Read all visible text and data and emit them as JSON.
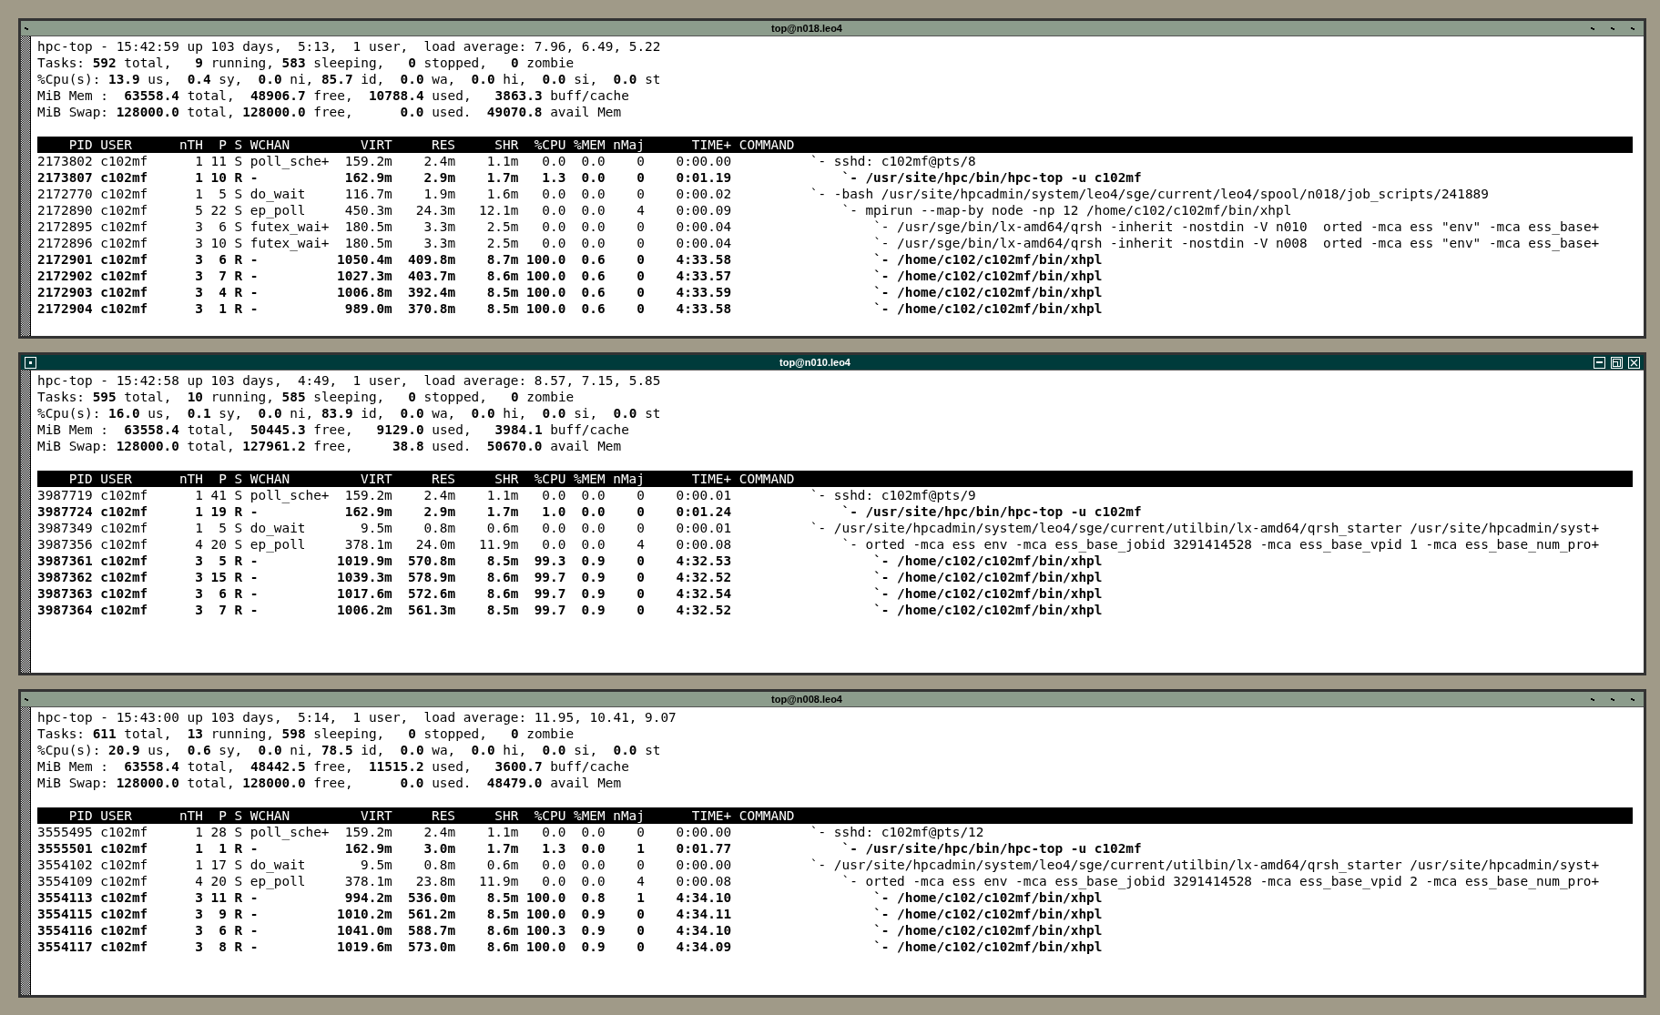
{
  "windows": [
    {
      "title": "top@n018.leo4",
      "active": false,
      "summary": [
        "hpc-top - 15:42:59 up 103 days,  5:13,  1 user,  load average: 7.96, 6.49, 5.22",
        "Tasks: **592** total,   **9** running, **583** sleeping,   **0** stopped,   **0** zombie",
        "%Cpu(s): **13.9** us,  **0.4** sy,  **0.0** ni, **85.7** id,  **0.0** wa,  **0.0** hi,  **0.0** si,  **0.0** st",
        "MiB Mem :  **63558.4** total,  **48906.7** free,  **10788.4** used,   **3863.3** buff/cache",
        "MiB Swap: **128000.0** total, **128000.0** free,      **0.0** used.  **49070.8** avail Mem"
      ],
      "columns": [
        "PID",
        "USER",
        "nTH",
        "P",
        "S",
        "WCHAN",
        "VIRT",
        "RES",
        "SHR",
        "%CPU",
        "%MEM",
        "nMaj",
        "TIME+",
        "COMMAND"
      ],
      "processes": [
        {
          "cells": [
            "2173802",
            "c102mf",
            "1",
            "11",
            "S",
            "poll_sche+",
            "159.2m",
            "2.4m",
            "1.1m",
            "0.0",
            "0.0",
            "0",
            "0:00.00"
          ],
          "command": "`- sshd: c102mf@pts/8",
          "highlighted": false,
          "children": [
            {
              "cells": [
                "2173807",
                "c102mf",
                "1",
                "10",
                "R",
                "-",
                "162.9m",
                "2.9m",
                "1.7m",
                "1.3",
                "0.0",
                "0",
                "0:01.19"
              ],
              "command": "`- /usr/site/hpc/bin/hpc-top -u c102mf",
              "highlighted": true
            }
          ]
        },
        {
          "cells": [
            "2172770",
            "c102mf",
            "1",
            "5",
            "S",
            "do_wait",
            "116.7m",
            "1.9m",
            "1.6m",
            "0.0",
            "0.0",
            "0",
            "0:00.02"
          ],
          "command": "`- -bash /usr/site/hpcadmin/system/leo4/sge/current/leo4/spool/n018/job_scripts/241889",
          "highlighted": false,
          "children": [
            {
              "cells": [
                "2172890",
                "c102mf",
                "5",
                "22",
                "S",
                "ep_poll",
                "450.3m",
                "24.3m",
                "12.1m",
                "0.0",
                "0.0",
                "4",
                "0:00.09"
              ],
              "command": "`- mpirun --map-by node -np 12 /home/c102/c102mf/bin/xhpl",
              "highlighted": false,
              "children": [
                {
                  "cells": [
                    "2172895",
                    "c102mf",
                    "3",
                    "6",
                    "S",
                    "futex_wai+",
                    "180.5m",
                    "3.3m",
                    "2.5m",
                    "0.0",
                    "0.0",
                    "0",
                    "0:00.04"
                  ],
                  "command": "`- /usr/sge/bin/lx-amd64/qrsh -inherit -nostdin -V n010  orted -mca ess \"env\" -mca ess_base+",
                  "highlighted": false
                },
                {
                  "cells": [
                    "2172896",
                    "c102mf",
                    "3",
                    "10",
                    "S",
                    "futex_wai+",
                    "180.5m",
                    "3.3m",
                    "2.5m",
                    "0.0",
                    "0.0",
                    "0",
                    "0:00.04"
                  ],
                  "command": "`- /usr/sge/bin/lx-amd64/qrsh -inherit -nostdin -V n008  orted -mca ess \"env\" -mca ess_base+",
                  "highlighted": false
                },
                {
                  "cells": [
                    "2172901",
                    "c102mf",
                    "3",
                    "6",
                    "R",
                    "-",
                    "1050.4m",
                    "409.8m",
                    "8.7m",
                    "100.0",
                    "0.6",
                    "0",
                    "4:33.58"
                  ],
                  "command": "`- /home/c102/c102mf/bin/xhpl",
                  "highlighted": true
                },
                {
                  "cells": [
                    "2172902",
                    "c102mf",
                    "3",
                    "7",
                    "R",
                    "-",
                    "1027.3m",
                    "403.7m",
                    "8.6m",
                    "100.0",
                    "0.6",
                    "0",
                    "4:33.57"
                  ],
                  "command": "`- /home/c102/c102mf/bin/xhpl",
                  "highlighted": true
                },
                {
                  "cells": [
                    "2172903",
                    "c102mf",
                    "3",
                    "4",
                    "R",
                    "-",
                    "1006.8m",
                    "392.4m",
                    "8.5m",
                    "100.0",
                    "0.6",
                    "0",
                    "4:33.59"
                  ],
                  "command": "`- /home/c102/c102mf/bin/xhpl",
                  "highlighted": true
                },
                {
                  "cells": [
                    "2172904",
                    "c102mf",
                    "3",
                    "1",
                    "R",
                    "-",
                    "989.0m",
                    "370.8m",
                    "8.5m",
                    "100.0",
                    "0.6",
                    "0",
                    "4:33.58"
                  ],
                  "command": "`- /home/c102/c102mf/bin/xhpl",
                  "highlighted": true
                }
              ]
            }
          ]
        }
      ]
    },
    {
      "title": "top@n010.leo4",
      "active": true,
      "summary": [
        "hpc-top - 15:42:58 up 103 days,  4:49,  1 user,  load average: 8.57, 7.15, 5.85",
        "Tasks: **595** total,  **10** running, **585** sleeping,   **0** stopped,   **0** zombie",
        "%Cpu(s): **16.0** us,  **0.1** sy,  **0.0** ni, **83.9** id,  **0.0** wa,  **0.0** hi,  **0.0** si,  **0.0** st",
        "MiB Mem :  **63558.4** total,  **50445.3** free,   **9129.0** used,   **3984.1** buff/cache",
        "MiB Swap: **128000.0** total, **127961.2** free,     **38.8** used.  **50670.0** avail Mem"
      ],
      "columns": [
        "PID",
        "USER",
        "nTH",
        "P",
        "S",
        "WCHAN",
        "VIRT",
        "RES",
        "SHR",
        "%CPU",
        "%MEM",
        "nMaj",
        "TIME+",
        "COMMAND"
      ],
      "processes": [
        {
          "cells": [
            "3987719",
            "c102mf",
            "1",
            "41",
            "S",
            "poll_sche+",
            "159.2m",
            "2.4m",
            "1.1m",
            "0.0",
            "0.0",
            "0",
            "0:00.01"
          ],
          "command": "`- sshd: c102mf@pts/9",
          "highlighted": false,
          "children": [
            {
              "cells": [
                "3987724",
                "c102mf",
                "1",
                "19",
                "R",
                "-",
                "162.9m",
                "2.9m",
                "1.7m",
                "1.0",
                "0.0",
                "0",
                "0:01.24"
              ],
              "command": "`- /usr/site/hpc/bin/hpc-top -u c102mf",
              "highlighted": true
            }
          ]
        },
        {
          "cells": [
            "3987349",
            "c102mf",
            "1",
            "5",
            "S",
            "do_wait",
            "9.5m",
            "0.8m",
            "0.6m",
            "0.0",
            "0.0",
            "0",
            "0:00.01"
          ],
          "command": "`- /usr/site/hpcadmin/system/leo4/sge/current/utilbin/lx-amd64/qrsh_starter /usr/site/hpcadmin/syst+",
          "highlighted": false,
          "children": [
            {
              "cells": [
                "3987356",
                "c102mf",
                "4",
                "20",
                "S",
                "ep_poll",
                "378.1m",
                "24.0m",
                "11.9m",
                "0.0",
                "0.0",
                "4",
                "0:00.08"
              ],
              "command": "`- orted -mca ess env -mca ess_base_jobid 3291414528 -mca ess_base_vpid 1 -mca ess_base_num_pro+",
              "highlighted": false,
              "children": [
                {
                  "cells": [
                    "3987361",
                    "c102mf",
                    "3",
                    "5",
                    "R",
                    "-",
                    "1019.9m",
                    "570.8m",
                    "8.5m",
                    "99.3",
                    "0.9",
                    "0",
                    "4:32.53"
                  ],
                  "command": "`- /home/c102/c102mf/bin/xhpl",
                  "highlighted": true
                },
                {
                  "cells": [
                    "3987362",
                    "c102mf",
                    "3",
                    "15",
                    "R",
                    "-",
                    "1039.3m",
                    "578.9m",
                    "8.6m",
                    "99.7",
                    "0.9",
                    "0",
                    "4:32.52"
                  ],
                  "command": "`- /home/c102/c102mf/bin/xhpl",
                  "highlighted": true
                },
                {
                  "cells": [
                    "3987363",
                    "c102mf",
                    "3",
                    "6",
                    "R",
                    "-",
                    "1017.6m",
                    "572.6m",
                    "8.6m",
                    "99.7",
                    "0.9",
                    "0",
                    "4:32.54"
                  ],
                  "command": "`- /home/c102/c102mf/bin/xhpl",
                  "highlighted": true
                },
                {
                  "cells": [
                    "3987364",
                    "c102mf",
                    "3",
                    "7",
                    "R",
                    "-",
                    "1006.2m",
                    "561.3m",
                    "8.5m",
                    "99.7",
                    "0.9",
                    "0",
                    "4:32.52"
                  ],
                  "command": "`- /home/c102/c102mf/bin/xhpl",
                  "highlighted": true
                }
              ]
            }
          ]
        }
      ]
    },
    {
      "title": "top@n008.leo4",
      "active": false,
      "summary": [
        "hpc-top - 15:43:00 up 103 days,  5:14,  1 user,  load average: 11.95, 10.41, 9.07",
        "Tasks: **611** total,  **13** running, **598** sleeping,   **0** stopped,   **0** zombie",
        "%Cpu(s): **20.9** us,  **0.6** sy,  **0.0** ni, **78.5** id,  **0.0** wa,  **0.0** hi,  **0.0** si,  **0.0** st",
        "MiB Mem :  **63558.4** total,  **48442.5** free,  **11515.2** used,   **3600.7** buff/cache",
        "MiB Swap: **128000.0** total, **128000.0** free,      **0.0** used.  **48479.0** avail Mem"
      ],
      "columns": [
        "PID",
        "USER",
        "nTH",
        "P",
        "S",
        "WCHAN",
        "VIRT",
        "RES",
        "SHR",
        "%CPU",
        "%MEM",
        "nMaj",
        "TIME+",
        "COMMAND"
      ],
      "processes": [
        {
          "cells": [
            "3555495",
            "c102mf",
            "1",
            "28",
            "S",
            "poll_sche+",
            "159.2m",
            "2.4m",
            "1.1m",
            "0.0",
            "0.0",
            "0",
            "0:00.00"
          ],
          "command": "`- sshd: c102mf@pts/12",
          "highlighted": false,
          "children": [
            {
              "cells": [
                "3555501",
                "c102mf",
                "1",
                "1",
                "R",
                "-",
                "162.9m",
                "3.0m",
                "1.7m",
                "1.3",
                "0.0",
                "1",
                "0:01.77"
              ],
              "command": "`- /usr/site/hpc/bin/hpc-top -u c102mf",
              "highlighted": true
            }
          ]
        },
        {
          "cells": [
            "3554102",
            "c102mf",
            "1",
            "17",
            "S",
            "do_wait",
            "9.5m",
            "0.8m",
            "0.6m",
            "0.0",
            "0.0",
            "0",
            "0:00.00"
          ],
          "command": "`- /usr/site/hpcadmin/system/leo4/sge/current/utilbin/lx-amd64/qrsh_starter /usr/site/hpcadmin/syst+",
          "highlighted": false,
          "children": [
            {
              "cells": [
                "3554109",
                "c102mf",
                "4",
                "20",
                "S",
                "ep_poll",
                "378.1m",
                "23.8m",
                "11.9m",
                "0.0",
                "0.0",
                "4",
                "0:00.08"
              ],
              "command": "`- orted -mca ess env -mca ess_base_jobid 3291414528 -mca ess_base_vpid 2 -mca ess_base_num_pro+",
              "highlighted": false,
              "children": [
                {
                  "cells": [
                    "3554113",
                    "c102mf",
                    "3",
                    "11",
                    "R",
                    "-",
                    "994.2m",
                    "536.0m",
                    "8.5m",
                    "100.0",
                    "0.8",
                    "1",
                    "4:34.10"
                  ],
                  "command": "`- /home/c102/c102mf/bin/xhpl",
                  "highlighted": true
                },
                {
                  "cells": [
                    "3554115",
                    "c102mf",
                    "3",
                    "9",
                    "R",
                    "-",
                    "1010.2m",
                    "561.2m",
                    "8.5m",
                    "100.0",
                    "0.9",
                    "0",
                    "4:34.11"
                  ],
                  "command": "`- /home/c102/c102mf/bin/xhpl",
                  "highlighted": true
                },
                {
                  "cells": [
                    "3554116",
                    "c102mf",
                    "3",
                    "6",
                    "R",
                    "-",
                    "1041.0m",
                    "588.7m",
                    "8.6m",
                    "100.3",
                    "0.9",
                    "0",
                    "4:34.10"
                  ],
                  "command": "`- /home/c102/c102mf/bin/xhpl",
                  "highlighted": true
                },
                {
                  "cells": [
                    "3554117",
                    "c102mf",
                    "3",
                    "8",
                    "R",
                    "-",
                    "1019.6m",
                    "573.0m",
                    "8.6m",
                    "100.0",
                    "0.9",
                    "0",
                    "4:34.09"
                  ],
                  "command": "`- /home/c102/c102mf/bin/xhpl",
                  "highlighted": true
                }
              ]
            }
          ]
        }
      ]
    }
  ]
}
